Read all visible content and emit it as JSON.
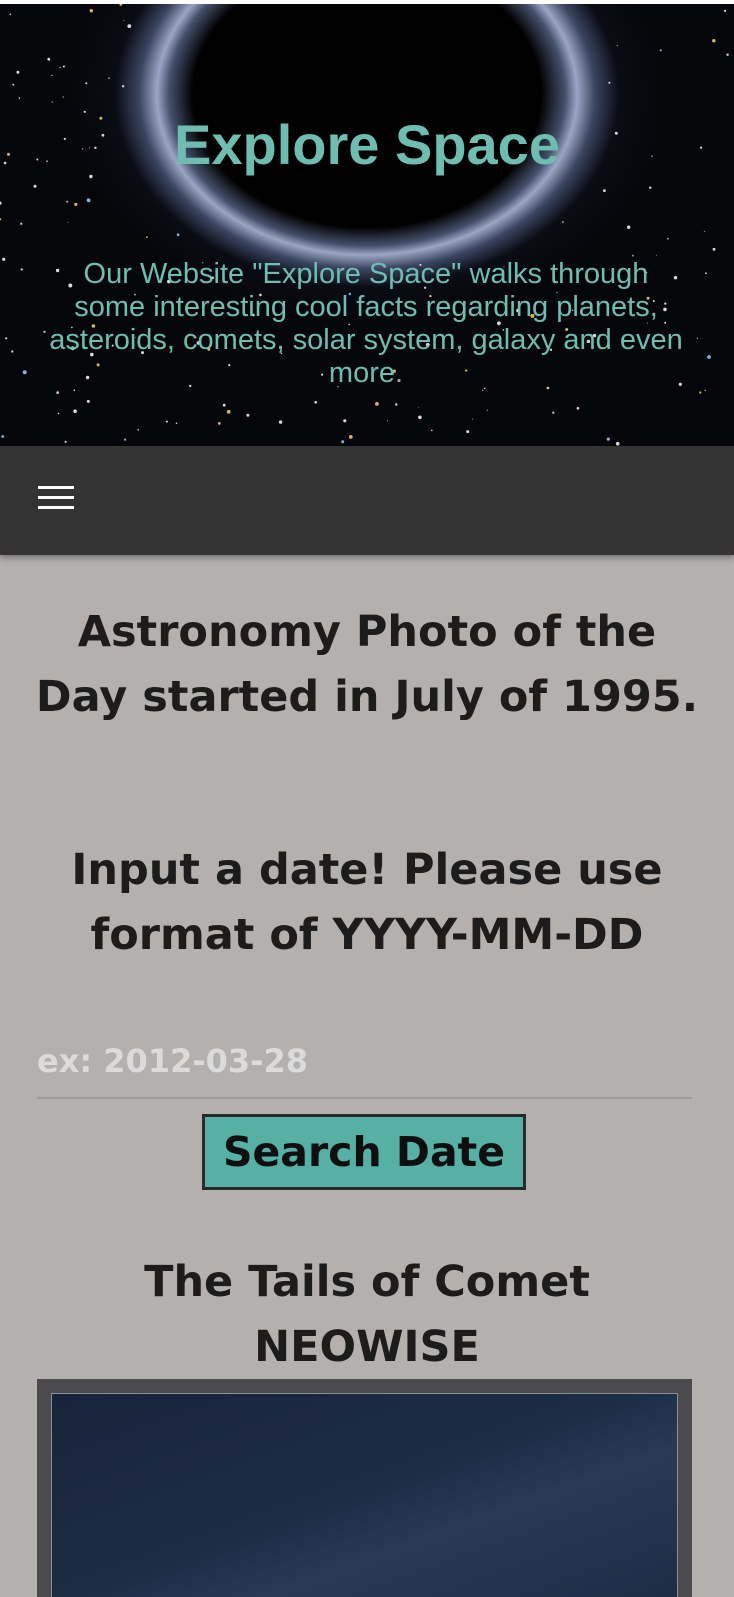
{
  "hero": {
    "title": "Explore Space",
    "description": "Our Website \"Explore Space\" walks through some interesting cool facts regarding planets, asteroids, comets, solar system, galaxy and even more."
  },
  "nav": {
    "menu_icon": "hamburger-menu-icon"
  },
  "main": {
    "intro_heading": "Astronomy Photo of the Day started in July of 1995.",
    "instruction_heading": "Input a date! Please use format of YYYY-MM-DD",
    "date_input": {
      "placeholder": "ex: 2012-03-28",
      "value": ""
    },
    "search_button_label": "Search Date",
    "photo_title": "The Tails of Comet NEOWISE"
  },
  "colors": {
    "accent": "#6fbdb1",
    "button": "#56b0a4",
    "background": "#b3b0ae",
    "navbar": "#333333"
  }
}
